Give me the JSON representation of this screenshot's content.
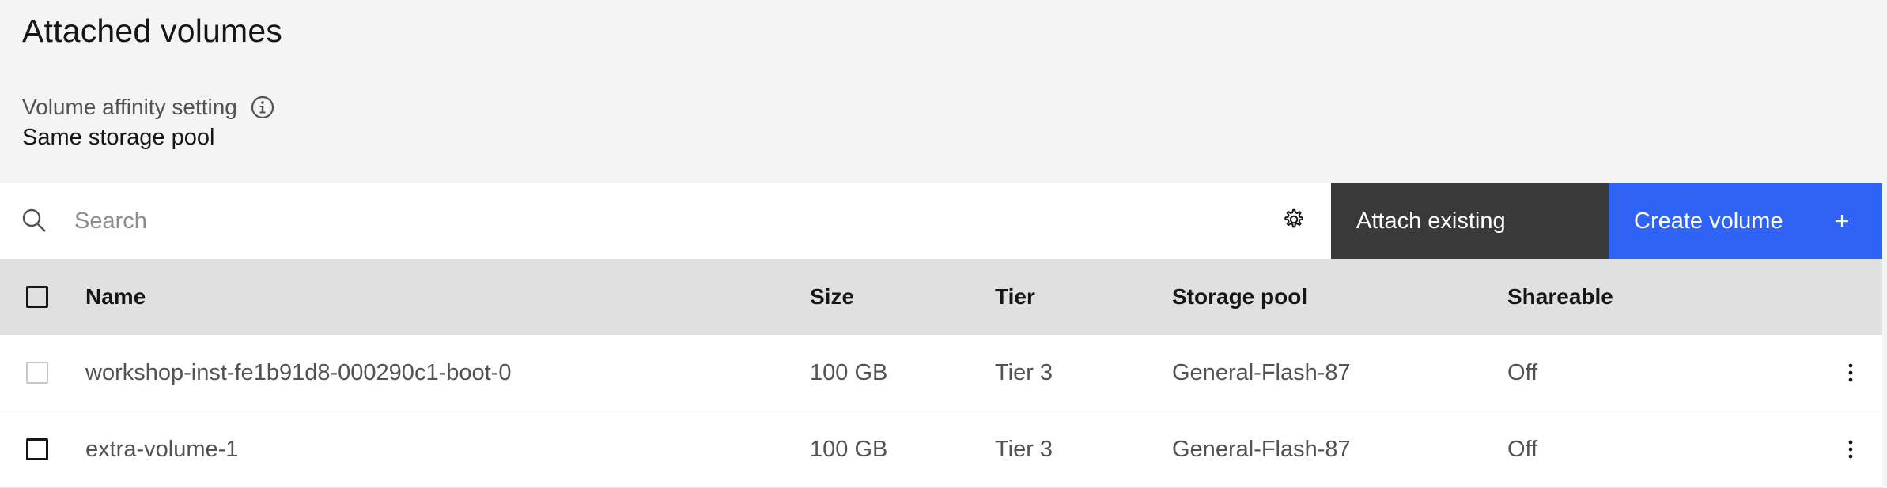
{
  "section": {
    "title": "Attached volumes",
    "affinity_label": "Volume affinity setting",
    "affinity_value": "Same storage pool"
  },
  "toolbar": {
    "search_placeholder": "Search",
    "search_value": "",
    "attach_label": "Attach existing",
    "create_label": "Create volume",
    "accent_color": "#2f63f6",
    "secondary_color": "#393939"
  },
  "table": {
    "columns": [
      "Name",
      "Size",
      "Tier",
      "Storage pool",
      "Shareable"
    ],
    "rows": [
      {
        "name": "workshop-inst-fe1b91d8-000290c1-boot-0",
        "size": "100 GB",
        "tier": "Tier 3",
        "pool": "General-Flash-87",
        "shareable": "Off",
        "selectable": false
      },
      {
        "name": "extra-volume-1",
        "size": "100 GB",
        "tier": "Tier 3",
        "pool": "General-Flash-87",
        "shareable": "Off",
        "selectable": true
      }
    ]
  },
  "icons": {
    "info": "information-icon",
    "search": "search-icon",
    "settings": "gear-icon",
    "add": "plus-icon",
    "row_menu": "overflow-menu-vertical-icon"
  }
}
